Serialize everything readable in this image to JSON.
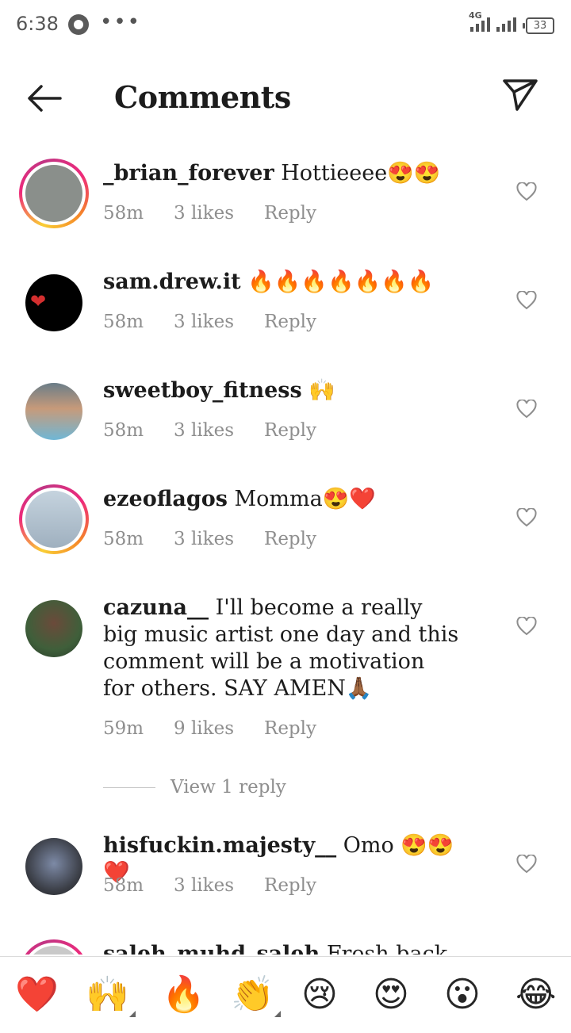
{
  "status_bar": {
    "time": "6:38",
    "dots": "•••",
    "network": "4G",
    "battery": "33"
  },
  "header": {
    "title": "Comments"
  },
  "comments": [
    {
      "username": "_brian_forever",
      "text": " Hottieeee😍😍",
      "time": "58m",
      "likes": "3 likes",
      "reply": "Reply",
      "ring": true,
      "avatar_color": "#8a8f8b"
    },
    {
      "username": "sam.drew.it",
      "text": " 🔥🔥🔥🔥🔥🔥🔥",
      "time": "58m",
      "likes": "3 likes",
      "reply": "Reply",
      "ring": false,
      "avatar_color": "#000000"
    },
    {
      "username": "sweetboy_fitness",
      "text": " 🙌",
      "time": "58m",
      "likes": "3 likes",
      "reply": "Reply",
      "ring": false,
      "avatar_color": "#7fb3c9"
    },
    {
      "username": "ezeoflagos",
      "text": " Momma😍❤️",
      "time": "58m",
      "likes": "3 likes",
      "reply": "Reply",
      "ring": true,
      "avatar_color": "#b7c2cc"
    },
    {
      "username": "cazuna__",
      "text": " I'll become a really big music artist one day and this comment will be a motivation for others. SAY AMEN🙏🏾",
      "time": "59m",
      "likes": "9 likes",
      "reply": "Reply",
      "ring": false,
      "avatar_color": "#3f5f3a"
    },
    {
      "username": "hisfuckin.majesty__",
      "text": " Omo 😍😍❤️",
      "time": "58m",
      "likes": "3 likes",
      "reply": "Reply",
      "ring": false,
      "avatar_color": "#3a3d45"
    },
    {
      "username": "saleh_muhd_saleh",
      "text": " Fresh back🔥",
      "ring": true,
      "avatar_color": "#c9c9c9"
    }
  ],
  "view_replies": {
    "label": "View 1 reply"
  },
  "emoji_bar": [
    "❤️",
    "🙌",
    "🔥",
    "👏",
    "😢",
    "😍",
    "😮",
    "😂"
  ],
  "colors": {
    "meta": "#8e8e8e",
    "ring_start": "#f9ce34",
    "ring_end": "#ee2a7b"
  }
}
